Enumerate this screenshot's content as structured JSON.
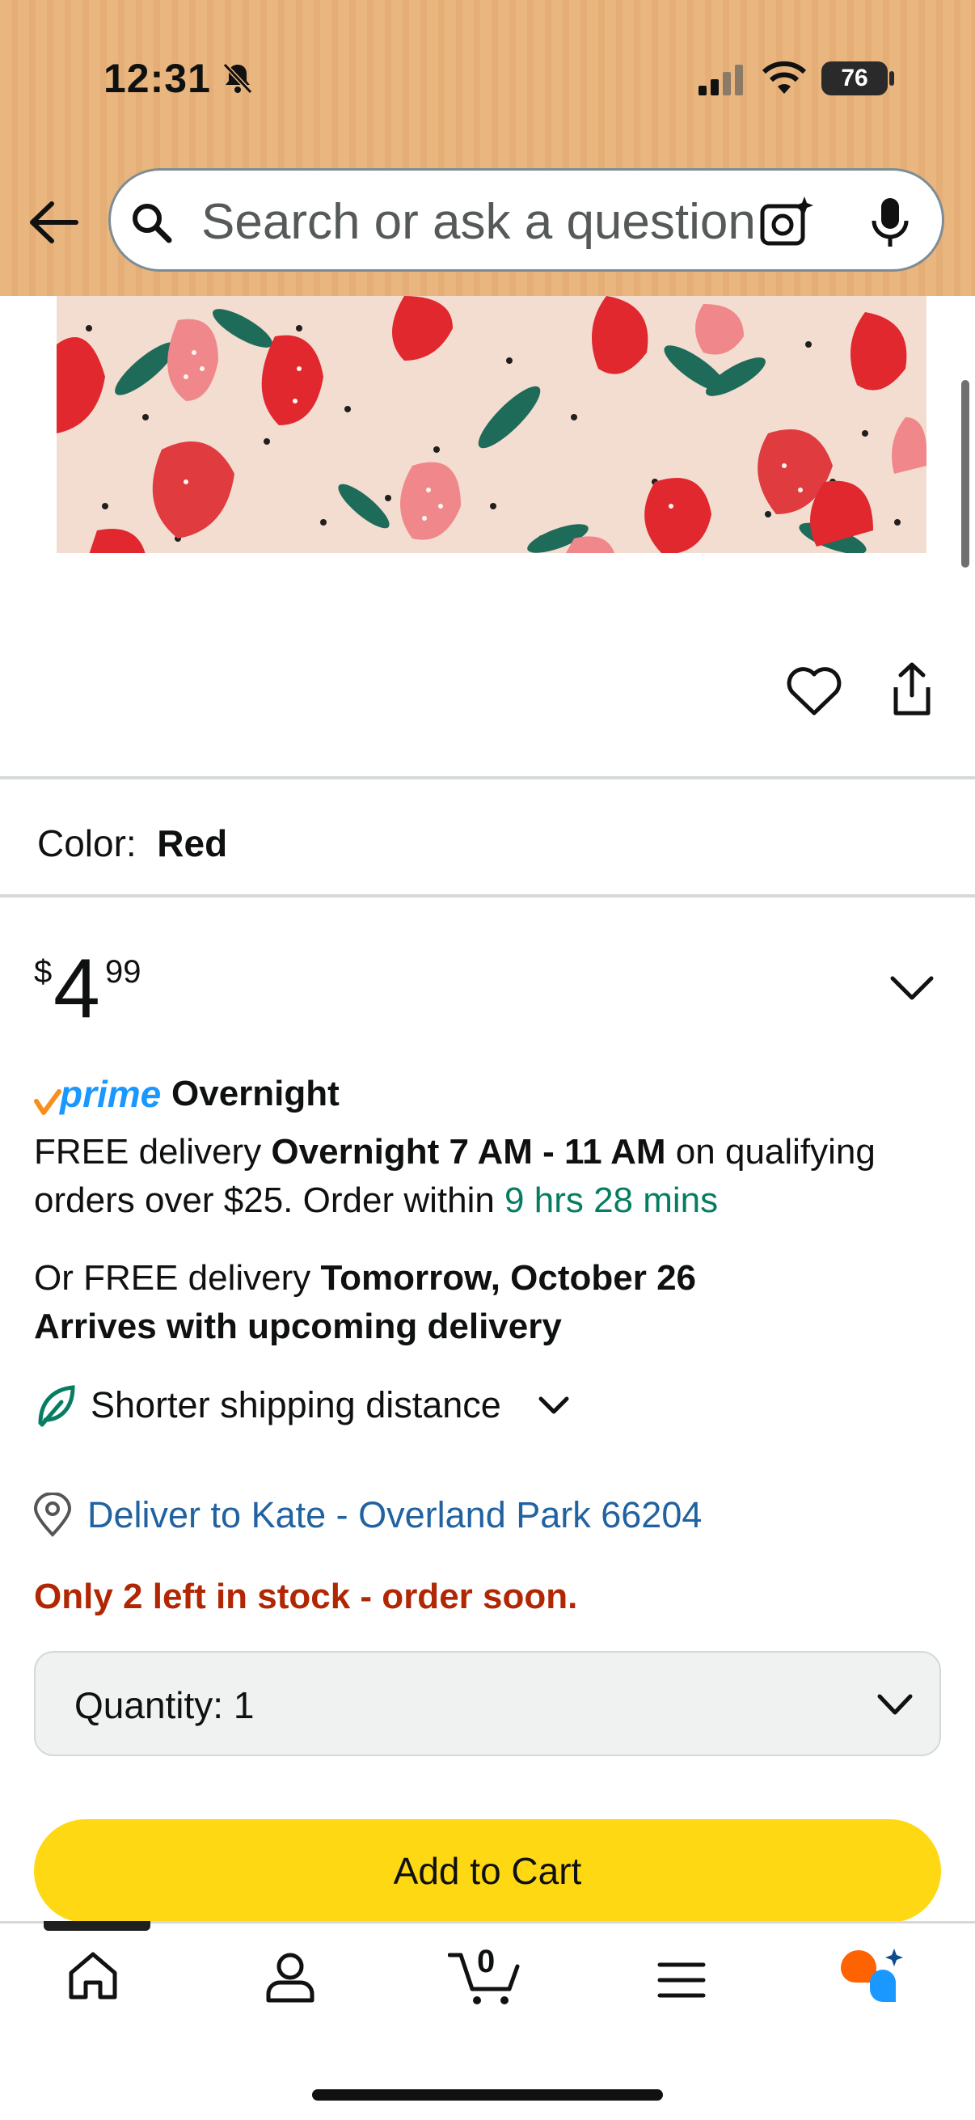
{
  "status_bar": {
    "time": "12:31",
    "battery": "76"
  },
  "search": {
    "placeholder": "Search or ask a question"
  },
  "product": {
    "color_label": "Color:",
    "color_value": "Red",
    "price_symbol": "$",
    "price_whole": "4",
    "price_fraction": "99"
  },
  "delivery": {
    "prime_word": "prime",
    "prime_service": "Overnight",
    "line1_prefix": "FREE delivery ",
    "line1_bold": "Overnight 7 AM - 11 AM",
    "line1_suffix": " on qualifying",
    "line2_prefix": "orders over $25. Order within ",
    "countdown": "9 hrs 28 mins",
    "alt_prefix": "Or FREE delivery ",
    "alt_bold": "Tomorrow, October 26",
    "arrives": "Arrives with upcoming delivery",
    "shipping": "Shorter shipping distance",
    "deliver_to": "Deliver to Kate - Overland Park 66204"
  },
  "stock": {
    "message": "Only 2 left in stock - order soon."
  },
  "quantity": {
    "label": "Quantity:",
    "value": "1"
  },
  "buttons": {
    "add_to_cart": "Add to Cart"
  },
  "bottom_nav": {
    "cart_count": "0"
  },
  "colors": {
    "accent_yellow": "#ffd814",
    "stock_red": "#b12704",
    "link_blue": "#2162a1",
    "prime_blue": "#1a98ff",
    "countdown_green": "#067d62"
  }
}
